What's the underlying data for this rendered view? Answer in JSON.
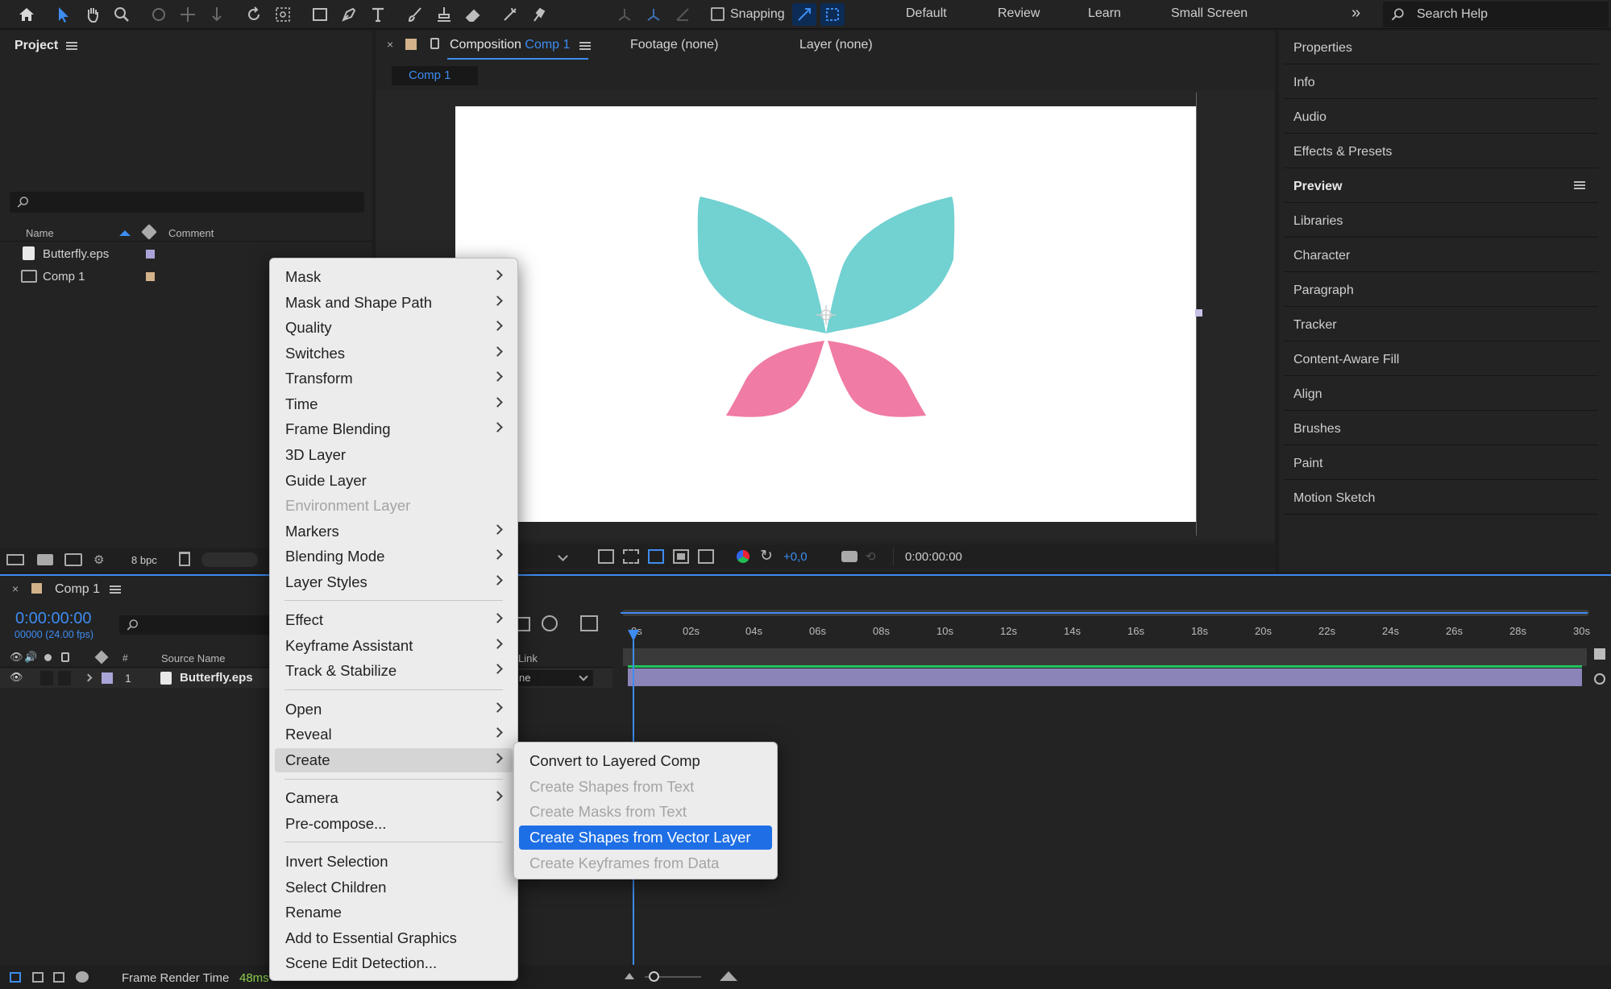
{
  "toolbar": {
    "snapping_label": "Snapping",
    "workspaces": [
      "Default",
      "Review",
      "Learn",
      "Small Screen"
    ],
    "search_placeholder": "Search Help"
  },
  "project_panel": {
    "title": "Project",
    "columns": {
      "name": "Name",
      "comment": "Comment"
    },
    "items": [
      {
        "name": "Butterfly.eps",
        "label_color": "#a9a4d8"
      },
      {
        "name": "Comp 1",
        "label_color": "#d2b28a"
      }
    ],
    "bpc": "8 bpc"
  },
  "viewer": {
    "tab_composition": "Composition",
    "tab_comp_name": "Comp 1",
    "tab_footage": "Footage (none)",
    "tab_layer": "Layer (none)",
    "sub_tab": "Comp 1",
    "exposure": "+0,0",
    "timecode": "0:00:00:00",
    "butterfly_colors": {
      "upper": "#72d1d1",
      "lower": "#f07ba4"
    }
  },
  "right_panel": {
    "items": [
      "Properties",
      "Info",
      "Audio",
      "Effects & Presets",
      "Preview",
      "Libraries",
      "Character",
      "Paragraph",
      "Tracker",
      "Content-Aware Fill",
      "Align",
      "Brushes",
      "Paint",
      "Motion Sketch"
    ]
  },
  "timeline": {
    "tab": "Comp 1",
    "timecode": "0:00:00:00",
    "frame_info": "00000 (24.00 fps)",
    "col_number": "#",
    "col_source": "Source Name",
    "col_link": "Link",
    "layer_number": "1",
    "layer_name": "Butterfly.eps",
    "parent_value": "ne",
    "ruler": [
      "0s",
      "02s",
      "04s",
      "06s",
      "08s",
      "10s",
      "12s",
      "14s",
      "16s",
      "18s",
      "20s",
      "22s",
      "24s",
      "26s",
      "28s",
      "30s"
    ],
    "footer_label": "Frame Render Time",
    "footer_value": "48ms"
  },
  "context_menu": {
    "items": [
      {
        "label": "Mask",
        "submenu": true
      },
      {
        "label": "Mask and Shape Path",
        "submenu": true
      },
      {
        "label": "Quality",
        "submenu": true
      },
      {
        "label": "Switches",
        "submenu": true
      },
      {
        "label": "Transform",
        "submenu": true
      },
      {
        "label": "Time",
        "submenu": true
      },
      {
        "label": "Frame Blending",
        "submenu": true
      },
      {
        "label": "3D Layer"
      },
      {
        "label": "Guide Layer"
      },
      {
        "label": "Environment Layer",
        "disabled": true
      },
      {
        "label": "Markers",
        "submenu": true
      },
      {
        "label": "Blending Mode",
        "submenu": true
      },
      {
        "label": "Layer Styles",
        "submenu": true
      },
      {
        "label": "Effect",
        "submenu": true
      },
      {
        "label": "Keyframe Assistant",
        "submenu": true
      },
      {
        "label": "Track & Stabilize",
        "submenu": true
      },
      {
        "label": "Open",
        "submenu": true
      },
      {
        "label": "Reveal",
        "submenu": true
      },
      {
        "label": "Create",
        "submenu": true,
        "highlighted": true
      },
      {
        "label": "Camera",
        "submenu": true
      },
      {
        "label": "Pre-compose..."
      },
      {
        "label": "Invert Selection"
      },
      {
        "label": "Select Children"
      },
      {
        "label": "Rename"
      },
      {
        "label": "Add to Essential Graphics"
      },
      {
        "label": "Scene Edit Detection..."
      }
    ]
  },
  "create_submenu": {
    "items": [
      {
        "label": "Convert to Layered Comp"
      },
      {
        "label": "Create Shapes from Text",
        "disabled": true
      },
      {
        "label": "Create Masks from Text",
        "disabled": true
      },
      {
        "label": "Create Shapes from Vector Layer",
        "selected": true
      },
      {
        "label": "Create Keyframes from Data",
        "disabled": true
      }
    ]
  }
}
